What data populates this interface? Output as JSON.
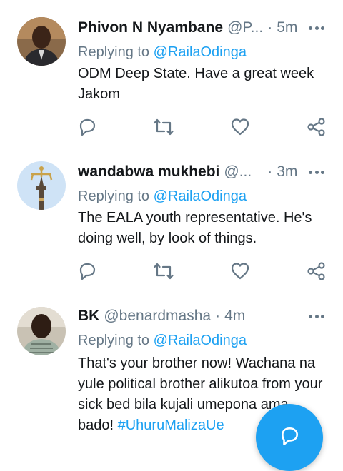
{
  "tweets": [
    {
      "name": "Phivon N Nyambane",
      "handle": "@P...",
      "separator": "·",
      "time": "5m",
      "reply_prefix": "Replying to ",
      "reply_to": "@RailaOdinga",
      "text": "ODM Deep State. Have a great week Jakom"
    },
    {
      "name": "wandabwa mukhebi",
      "handle": "@...",
      "separator": "·",
      "time": "3m",
      "reply_prefix": "Replying to ",
      "reply_to": "@RailaOdinga",
      "text": "The EALA youth representative. He's doing well, by look of things."
    },
    {
      "name": "BK",
      "handle": "@benardmasha",
      "separator": "·",
      "time": "4m",
      "reply_prefix": "Replying to ",
      "reply_to": "@RailaOdinga",
      "text": "That's your brother now! Wachana na yule political brother alikutoa from your sick bed bila kujali umepona ama bado! ",
      "hashtag": "#UhuruMalizaUe"
    }
  ],
  "icons": {
    "reply": "reply-icon",
    "retweet": "retweet-icon",
    "like": "heart-icon",
    "share": "share-icon",
    "more": "more-options-icon",
    "compose": "compose-reply-icon"
  },
  "colors": {
    "accent": "#1da1f2",
    "secondary_text": "#657786",
    "divider": "#e6ecf0"
  }
}
